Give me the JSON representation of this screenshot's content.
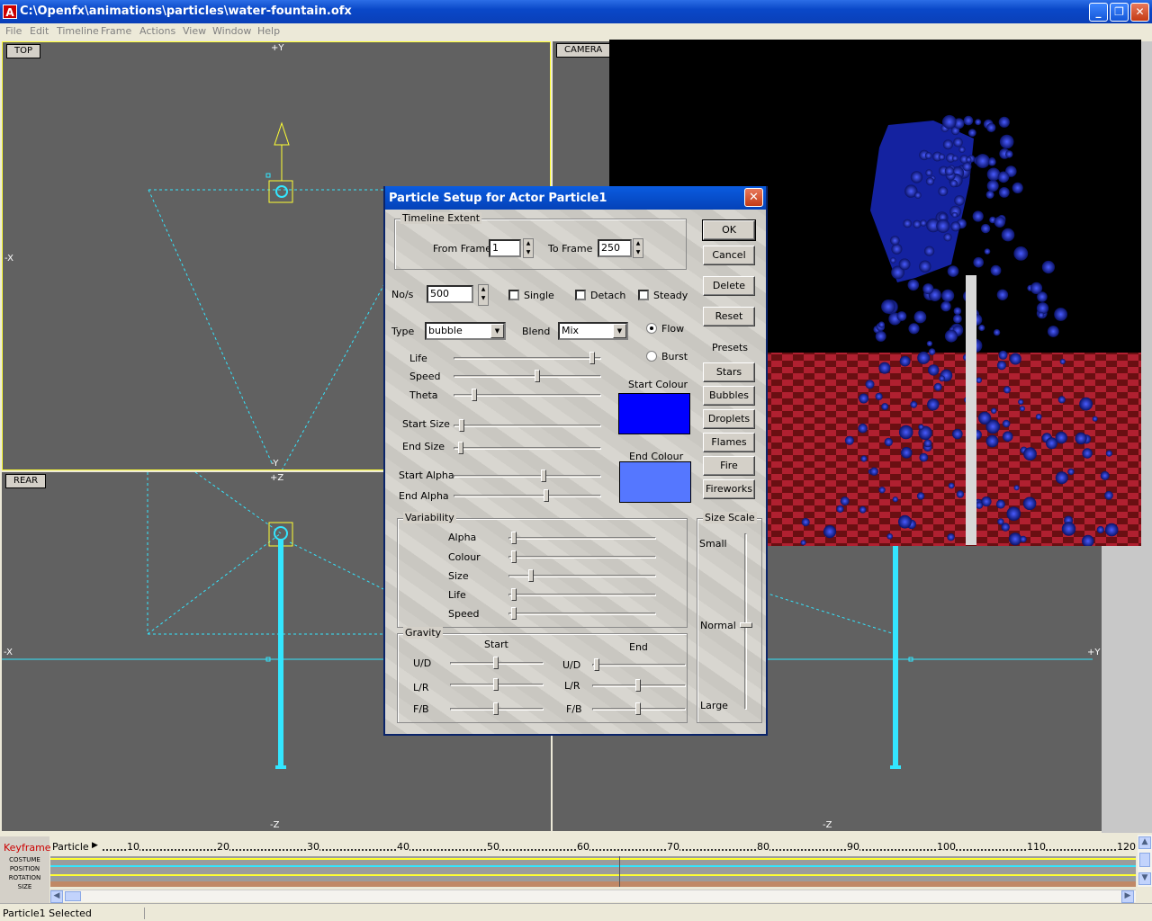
{
  "window": {
    "title": "C:\\Openfx\\animations\\particles\\water-fountain.ofx",
    "minimize": "_",
    "maximize": "❐",
    "close": "✕"
  },
  "menu": [
    "File",
    "Edit",
    "Timeline",
    "Frame",
    "Actions",
    "View",
    "Window",
    "Help"
  ],
  "viewports": {
    "top": {
      "label": "TOP",
      "axes": {
        "up": "+Y",
        "down": "-Y",
        "left": "-X"
      }
    },
    "camera": {
      "label": "CAMERA",
      "axes": {
        "down": "-Z",
        "right": "+Y"
      }
    },
    "rear": {
      "label": "REAR",
      "axes": {
        "up": "+Z",
        "down": "-Z",
        "left": "-X"
      }
    }
  },
  "dialog": {
    "title": "Particle Setup for Actor Particle1",
    "close": "✕",
    "timeline_extent": {
      "label": "Timeline Extent",
      "from_label": "From Frame",
      "from_value": "1",
      "to_label": "To Frame",
      "to_value": "250"
    },
    "nos": {
      "label": "No/s",
      "value": "500"
    },
    "checkboxes": {
      "single": "Single",
      "detach": "Detach",
      "steady": "Steady"
    },
    "type": {
      "label": "Type",
      "value": "bubble"
    },
    "blend": {
      "label": "Blend",
      "value": "Mix"
    },
    "radios": {
      "flow": "Flow",
      "burst": "Burst",
      "selected": "Flow"
    },
    "sliders": {
      "life": {
        "label": "Life",
        "value": 0.97
      },
      "speed": {
        "label": "Speed",
        "value": 0.58
      },
      "theta": {
        "label": "Theta",
        "value": 0.13
      },
      "start_size": {
        "label": "Start Size",
        "value": 0.04
      },
      "end_size": {
        "label": "End Size",
        "value": 0.03
      },
      "start_alpha": {
        "label": "Start Alpha",
        "value": 0.62
      },
      "end_alpha": {
        "label": "End Alpha",
        "value": 0.64
      }
    },
    "start_colour": {
      "label": "Start Colour",
      "color": "#0000ff"
    },
    "end_colour": {
      "label": "End Colour",
      "color": "#5577ff"
    },
    "variability": {
      "label": "Variability",
      "alpha": {
        "label": "Alpha",
        "value": 0.02
      },
      "colour": {
        "label": "Colour",
        "value": 0.02
      },
      "size": {
        "label": "Size",
        "value": 0.14
      },
      "life": {
        "label": "Life",
        "value": 0.02
      },
      "speed": {
        "label": "Speed",
        "value": 0.02
      }
    },
    "gravity": {
      "label": "Gravity",
      "start_label": "Start",
      "end_label": "End",
      "ud_label": "U/D",
      "lr_label": "L/R",
      "fb_label": "F/B",
      "start": {
        "ud": 0.5,
        "lr": 0.5,
        "fb": 0.5
      },
      "end": {
        "ud": 0.02,
        "lr": 0.5,
        "fb": 0.5
      }
    },
    "size_scale": {
      "label": "Size Scale",
      "small": "Small",
      "normal": "Normal",
      "large": "Large",
      "value": 0.52
    },
    "buttons": {
      "ok": "OK",
      "cancel": "Cancel",
      "delete": "Delete",
      "reset": "Reset"
    },
    "presets": {
      "label": "Presets",
      "items": [
        "Stars",
        "Bubbles",
        "Droplets",
        "Flames",
        "Fire",
        "Fireworks"
      ]
    }
  },
  "timeline": {
    "keyframer": "Keyframer",
    "tracks": [
      "COSTUME",
      "POSITION",
      "ROTATION",
      "SIZE"
    ],
    "actor": "Particle",
    "ticks": [
      "10",
      "20",
      "30",
      "40",
      "50",
      "60",
      "70",
      "80",
      "90",
      "100",
      "110",
      "120"
    ]
  },
  "status": "Particle1 Selected",
  "colors": {
    "wire": "#33e6ff",
    "select": "#ffff33",
    "bubble": "#1a2aa0",
    "floor_a": "#6a0f12",
    "floor_b": "#c02a38"
  }
}
